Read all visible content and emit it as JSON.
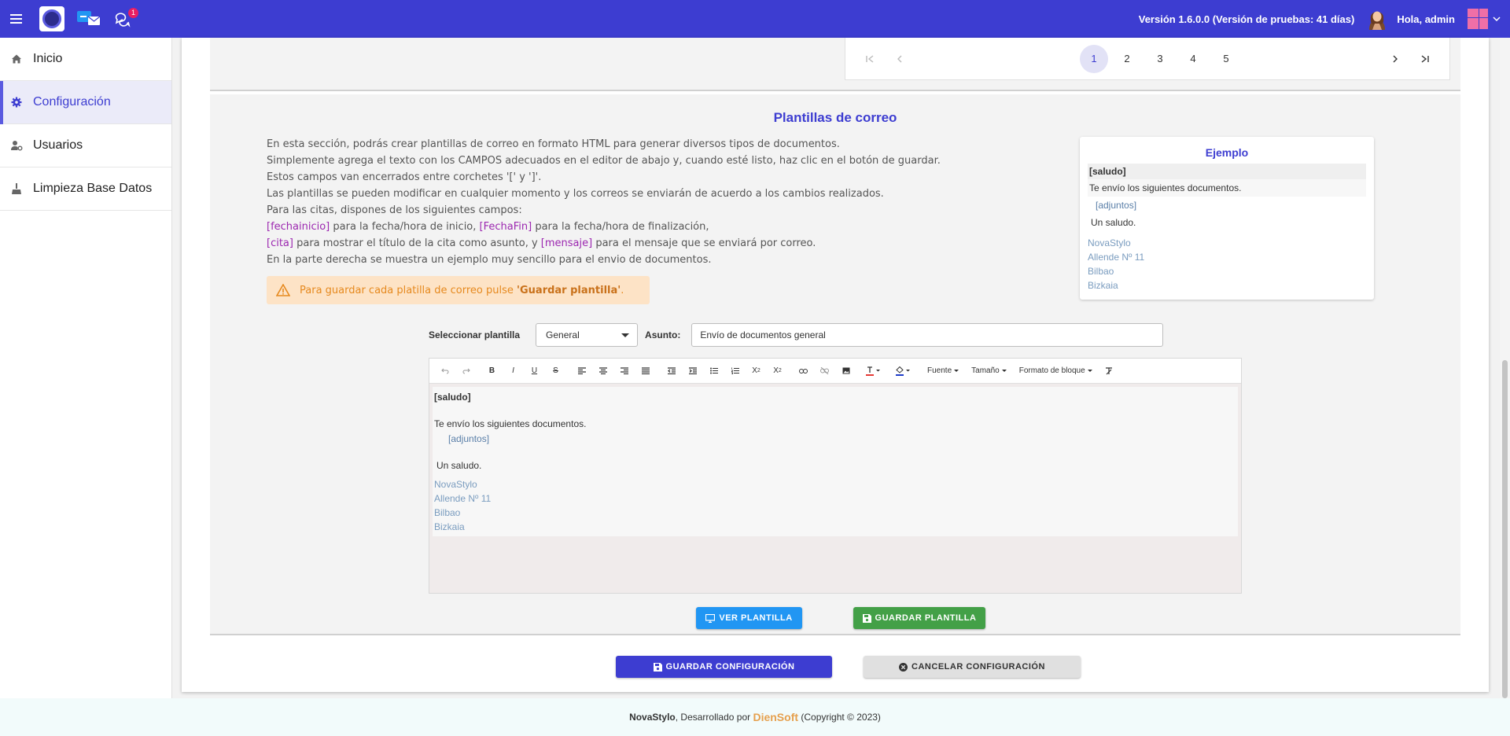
{
  "topbar": {
    "chat_badge": "1",
    "version": "Versión 1.6.0.0 (Versión de pruebas: 41 días)",
    "greeting": "Hola, admin"
  },
  "sidebar": {
    "items": [
      {
        "label": "Inicio",
        "icon": "home-icon"
      },
      {
        "label": "Configuración",
        "icon": "gear-icon",
        "active": true
      },
      {
        "label": "Usuarios",
        "icon": "user-cog-icon"
      },
      {
        "label": "Limpieza Base Datos",
        "icon": "broom-icon"
      }
    ]
  },
  "pagination": {
    "pages": [
      "1",
      "2",
      "3",
      "4",
      "5"
    ],
    "current": "1"
  },
  "templates": {
    "title": "Plantillas de correo",
    "desc": {
      "line1": "En esta sección, podrás crear plantillas de correo en formato HTML para generar diversos tipos de documentos.",
      "line2": "Simplemente agrega el texto con los CAMPOS adecuados en el editor de abajo y, cuando esté listo, haz clic en el botón de guardar.",
      "line3": "Estos campos van encerrados entre corchetes '[' y ']'.",
      "line4": "Las plantillas se pueden modificar en cualquier momento y los correos se enviarán de acuerdo a los cambios realizados.",
      "line5": "Para las citas, dispones de los siguientes campos:",
      "kw_fechainicio": "[fechainicio]",
      "txt_fechainicio": " para la fecha/hora de inicio, ",
      "kw_fechafin": "[FechaFin]",
      "txt_fechafin": " para la fecha/hora de finalización,",
      "kw_cita": "[cita]",
      "txt_cita": " para mostrar el título de la cita como asunto, y ",
      "kw_mensaje": "[mensaje]",
      "txt_mensaje": " para el mensaje que se enviará por correo.",
      "line8": "En la parte derecha se muestra un ejemplo muy sencillo para el envio de documentos."
    },
    "warning": {
      "text": "Para guardar cada platilla de correo pulse ",
      "bold": "'Guardar plantilla'",
      "end": "."
    },
    "example": {
      "title": "Ejemplo",
      "saludo": "[saludo]",
      "line": "Te envío los siguientes documentos.",
      "adjuntos": "[adjuntos]",
      "closing": "Un saludo.",
      "addr1": "NovaStylo",
      "addr2": "Allende Nº 11",
      "addr3": "Bilbao",
      "addr4": "Bizkaia"
    },
    "form": {
      "select_label": "Seleccionar plantilla",
      "select_value": "General",
      "subject_label": "Asunto:",
      "subject_value": "Envío de documentos general"
    },
    "editor": {
      "toolbar": {
        "font": "Fuente",
        "size": "Tamaño",
        "block": "Formato de bloque"
      },
      "saludo": "[saludo]",
      "line": "Te envío los siguientes documentos.",
      "adjuntos": "[adjuntos]",
      "closing": "Un saludo.",
      "addr1": "NovaStylo",
      "addr2": "Allende Nº 11",
      "addr3": "Bilbao",
      "addr4": "Bizkaia"
    },
    "btn_ver": "VER PLANTILLA",
    "btn_guardar": "GUARDAR PLANTILLA"
  },
  "actions": {
    "save": "GUARDAR CONFIGURACIÓN",
    "cancel": "CANCELAR CONFIGURACIÓN"
  },
  "footer": {
    "brand": "NovaStylo",
    "mid": ", Desarrollado por ",
    "dev": "DienSoft",
    "copy": " (Copyright © 2023)"
  },
  "colors": {
    "primary": "#3d3dd1",
    "accent_keyword": "#9c27b0",
    "success": "#43a047",
    "info": "#2196f3",
    "warning_bg": "#fde3c6"
  }
}
